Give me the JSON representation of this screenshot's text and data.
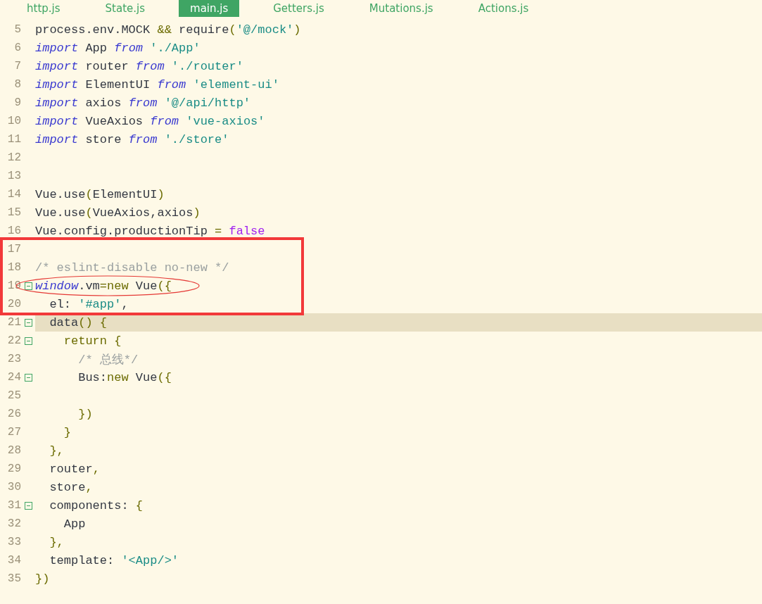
{
  "tabs": [
    {
      "label": "http.js",
      "selected": false
    },
    {
      "label": "State.js",
      "selected": false
    },
    {
      "label": "main.js",
      "selected": true
    },
    {
      "label": "Getters.js",
      "selected": false
    },
    {
      "label": "Mutations.js",
      "selected": false
    },
    {
      "label": "Actions.js",
      "selected": false
    }
  ],
  "lines": [
    {
      "number": "5",
      "fold": false,
      "current": false,
      "boxed": false,
      "circled": false,
      "tokens": [
        {
          "kind": "plain",
          "text": "process.env.MOCK "
        },
        {
          "kind": "punct",
          "text": "&&"
        },
        {
          "kind": "plain",
          "text": " require"
        },
        {
          "kind": "punct",
          "text": "("
        },
        {
          "kind": "string",
          "text": "'@/mock'"
        },
        {
          "kind": "punct",
          "text": ")"
        }
      ]
    },
    {
      "number": "6",
      "fold": false,
      "current": false,
      "boxed": false,
      "circled": false,
      "tokens": [
        {
          "kind": "keyword",
          "text": "import"
        },
        {
          "kind": "plain",
          "text": " App "
        },
        {
          "kind": "keyword",
          "text": "from"
        },
        {
          "kind": "string",
          "text": " './App'"
        }
      ]
    },
    {
      "number": "7",
      "fold": false,
      "current": false,
      "boxed": false,
      "circled": false,
      "tokens": [
        {
          "kind": "keyword",
          "text": "import"
        },
        {
          "kind": "plain",
          "text": " router "
        },
        {
          "kind": "keyword",
          "text": "from"
        },
        {
          "kind": "string",
          "text": " './router'"
        }
      ]
    },
    {
      "number": "8",
      "fold": false,
      "current": false,
      "boxed": false,
      "circled": false,
      "tokens": [
        {
          "kind": "keyword",
          "text": "import"
        },
        {
          "kind": "plain",
          "text": " ElementUI "
        },
        {
          "kind": "keyword",
          "text": "from"
        },
        {
          "kind": "string",
          "text": " 'element-ui'"
        }
      ]
    },
    {
      "number": "9",
      "fold": false,
      "current": false,
      "boxed": false,
      "circled": false,
      "tokens": [
        {
          "kind": "keyword",
          "text": "import"
        },
        {
          "kind": "plain",
          "text": " axios "
        },
        {
          "kind": "keyword",
          "text": "from"
        },
        {
          "kind": "string",
          "text": " '@/api/http'"
        }
      ]
    },
    {
      "number": "10",
      "fold": false,
      "current": false,
      "boxed": false,
      "circled": false,
      "tokens": [
        {
          "kind": "keyword",
          "text": "import"
        },
        {
          "kind": "plain",
          "text": " VueAxios "
        },
        {
          "kind": "keyword",
          "text": "from"
        },
        {
          "kind": "string",
          "text": " 'vue-axios'"
        }
      ]
    },
    {
      "number": "11",
      "fold": false,
      "current": false,
      "boxed": false,
      "circled": false,
      "tokens": [
        {
          "kind": "keyword",
          "text": "import"
        },
        {
          "kind": "plain",
          "text": " store "
        },
        {
          "kind": "keyword",
          "text": "from"
        },
        {
          "kind": "string",
          "text": " './store'"
        }
      ]
    },
    {
      "number": "12",
      "fold": false,
      "current": false,
      "boxed": false,
      "circled": false
    },
    {
      "number": "13",
      "fold": false,
      "current": false,
      "boxed": false,
      "circled": false
    },
    {
      "number": "14",
      "fold": false,
      "current": false,
      "boxed": false,
      "circled": false,
      "tokens": [
        {
          "kind": "plain",
          "text": "Vue.use"
        },
        {
          "kind": "punct",
          "text": "("
        },
        {
          "kind": "plain",
          "text": "ElementUI"
        },
        {
          "kind": "punct",
          "text": ")"
        }
      ]
    },
    {
      "number": "15",
      "fold": false,
      "current": false,
      "boxed": false,
      "circled": false,
      "tokens": [
        {
          "kind": "plain",
          "text": "Vue.use"
        },
        {
          "kind": "punct",
          "text": "("
        },
        {
          "kind": "plain",
          "text": "VueAxios,axios"
        },
        {
          "kind": "punct",
          "text": ")"
        }
      ]
    },
    {
      "number": "16",
      "fold": false,
      "current": false,
      "boxed": false,
      "circled": false,
      "tokens": [
        {
          "kind": "plain",
          "text": "Vue.config.productionTip "
        },
        {
          "kind": "punct",
          "text": "="
        },
        {
          "kind": "boolean",
          "text": " false"
        }
      ]
    },
    {
      "number": "17",
      "fold": false,
      "current": false,
      "boxed": true,
      "circled": false
    },
    {
      "number": "18",
      "fold": false,
      "current": false,
      "boxed": true,
      "circled": false,
      "tokens": [
        {
          "kind": "comment",
          "text": "/* eslint-disable no-new */"
        }
      ]
    },
    {
      "number": "19",
      "fold": true,
      "current": false,
      "boxed": true,
      "circled": true,
      "tokens": [
        {
          "kind": "variable",
          "text": "window"
        },
        {
          "kind": "plain",
          "text": ".vm"
        },
        {
          "kind": "punct",
          "text": "=new"
        },
        {
          "kind": "plain",
          "text": " Vue"
        },
        {
          "kind": "punct",
          "text": "({"
        }
      ]
    },
    {
      "number": "20",
      "fold": false,
      "current": false,
      "boxed": true,
      "circled": false,
      "tokens": [
        {
          "kind": "plain",
          "text": "  el: "
        },
        {
          "kind": "string",
          "text": "'#app'"
        },
        {
          "kind": "plain",
          "text": ","
        }
      ]
    },
    {
      "number": "21",
      "fold": true,
      "current": true,
      "boxed": false,
      "circled": false,
      "tokens": [
        {
          "kind": "plain",
          "text": "  data"
        },
        {
          "kind": "punct",
          "text": "() {"
        }
      ]
    },
    {
      "number": "22",
      "fold": true,
      "current": false,
      "boxed": false,
      "circled": false,
      "tokens": [
        {
          "kind": "punct",
          "text": "    return {"
        }
      ]
    },
    {
      "number": "23",
      "fold": false,
      "current": false,
      "boxed": false,
      "circled": false,
      "tokens": [
        {
          "kind": "comment",
          "text": "      /* 总线*/"
        }
      ]
    },
    {
      "number": "24",
      "fold": true,
      "current": false,
      "boxed": false,
      "circled": false,
      "tokens": [
        {
          "kind": "plain",
          "text": "      Bus:"
        },
        {
          "kind": "punct",
          "text": "new"
        },
        {
          "kind": "plain",
          "text": " Vue"
        },
        {
          "kind": "punct",
          "text": "({"
        }
      ]
    },
    {
      "number": "25",
      "fold": false,
      "current": false,
      "boxed": false,
      "circled": false
    },
    {
      "number": "26",
      "fold": false,
      "current": false,
      "boxed": false,
      "circled": false,
      "tokens": [
        {
          "kind": "punct",
          "text": "      })"
        }
      ]
    },
    {
      "number": "27",
      "fold": false,
      "current": false,
      "boxed": false,
      "circled": false,
      "tokens": [
        {
          "kind": "punct",
          "text": "    }"
        }
      ]
    },
    {
      "number": "28",
      "fold": false,
      "current": false,
      "boxed": false,
      "circled": false,
      "tokens": [
        {
          "kind": "punct",
          "text": "  },"
        }
      ]
    },
    {
      "number": "29",
      "fold": false,
      "current": false,
      "boxed": false,
      "circled": false,
      "tokens": [
        {
          "kind": "plain",
          "text": "  router"
        },
        {
          "kind": "punct",
          "text": ","
        }
      ]
    },
    {
      "number": "30",
      "fold": false,
      "current": false,
      "boxed": false,
      "circled": false,
      "tokens": [
        {
          "kind": "plain",
          "text": "  store"
        },
        {
          "kind": "punct",
          "text": ","
        }
      ]
    },
    {
      "number": "31",
      "fold": true,
      "current": false,
      "boxed": false,
      "circled": false,
      "tokens": [
        {
          "kind": "plain",
          "text": "  components: "
        },
        {
          "kind": "punct",
          "text": "{"
        }
      ]
    },
    {
      "number": "32",
      "fold": false,
      "current": false,
      "boxed": false,
      "circled": false,
      "tokens": [
        {
          "kind": "plain",
          "text": "    App"
        }
      ]
    },
    {
      "number": "33",
      "fold": false,
      "current": false,
      "boxed": false,
      "circled": false,
      "tokens": [
        {
          "kind": "punct",
          "text": "  },"
        }
      ]
    },
    {
      "number": "34",
      "fold": false,
      "current": false,
      "boxed": false,
      "circled": false,
      "tokens": [
        {
          "kind": "plain",
          "text": "  template: "
        },
        {
          "kind": "string",
          "text": "'<App/>'"
        }
      ]
    },
    {
      "number": "35",
      "fold": false,
      "current": false,
      "boxed": false,
      "circled": false,
      "tokens": [
        {
          "kind": "punct",
          "text": "})"
        }
      ]
    }
  ]
}
